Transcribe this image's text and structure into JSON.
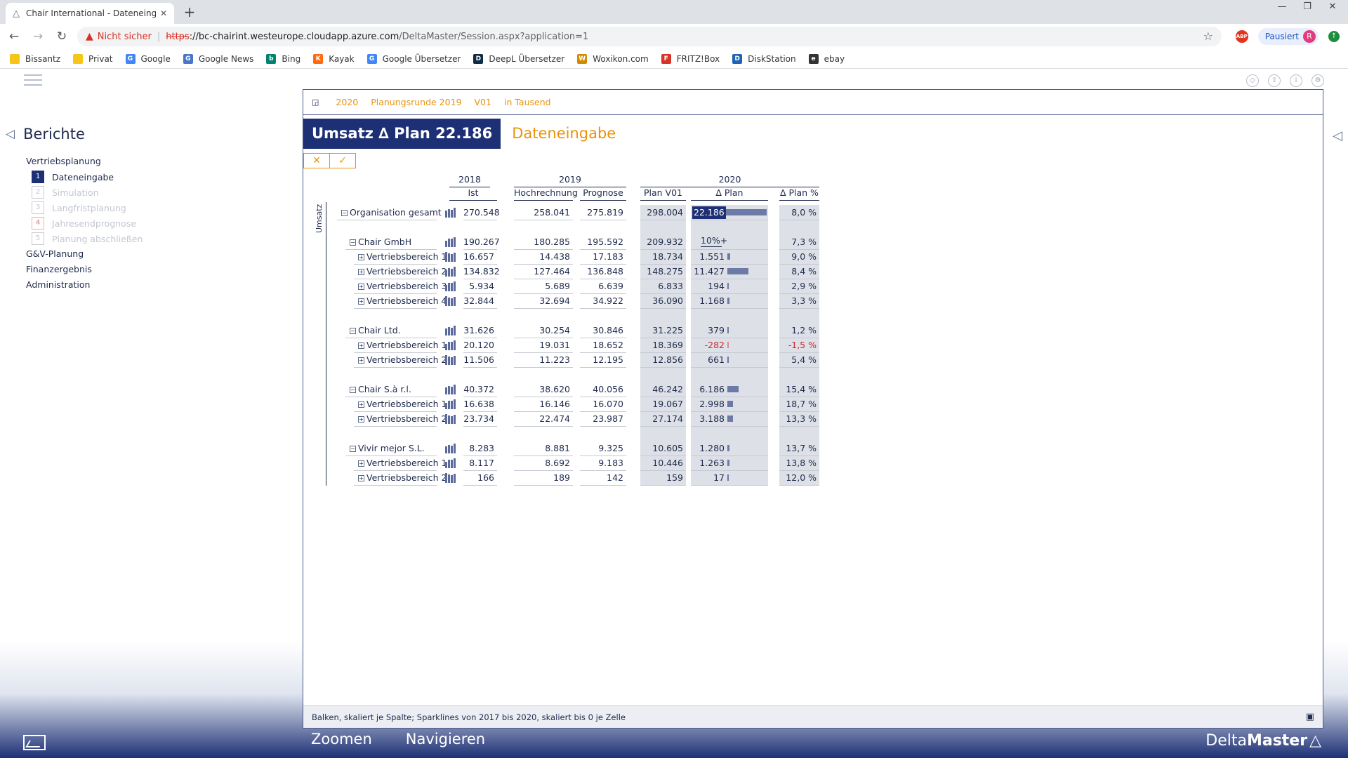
{
  "browser": {
    "tab_title": "Chair International - Dateneingabe",
    "new_tab": "+",
    "address": {
      "warning": "Nicht sicher",
      "scheme": "https",
      "host": "://bc-chairint.westeurope.cloudapp.azure.com",
      "path": "/DeltaMaster/Session.aspx?application=1"
    },
    "paused_label": "Pausiert",
    "profile_initial": "R",
    "abp_label": "ABP",
    "bookmarks": [
      {
        "label": "Bissantz",
        "color": "#f5c518"
      },
      {
        "label": "Privat",
        "color": "#f5c518"
      },
      {
        "label": "Google",
        "color": "#4285f4",
        "glyph": "G"
      },
      {
        "label": "Google News",
        "color": "#4a76c9",
        "glyph": "G"
      },
      {
        "label": "Bing",
        "color": "#008272",
        "glyph": "b"
      },
      {
        "label": "Kayak",
        "color": "#ff690f",
        "glyph": "K"
      },
      {
        "label": "Google Übersetzer",
        "color": "#4285f4",
        "glyph": "G"
      },
      {
        "label": "DeepL Übersetzer",
        "color": "#0f2b46",
        "glyph": "D"
      },
      {
        "label": "Woxikon.com",
        "color": "#d48a00",
        "glyph": "W"
      },
      {
        "label": "FRITZ!Box",
        "color": "#d9322b",
        "glyph": "F"
      },
      {
        "label": "DiskStation",
        "color": "#1e63b5",
        "glyph": "D"
      },
      {
        "label": "ebay",
        "color": "#333333",
        "glyph": "e"
      }
    ]
  },
  "nav": {
    "title": "Berichte",
    "groups_before": [
      "Vertriebsplanung"
    ],
    "steps": [
      {
        "num": "1",
        "label": "Dateneingabe",
        "state": "active"
      },
      {
        "num": "2",
        "label": "Simulation",
        "state": ""
      },
      {
        "num": "3",
        "label": "Langfristplanung",
        "state": ""
      },
      {
        "num": "4",
        "label": "Jahresendprognose",
        "state": "warn"
      },
      {
        "num": "5",
        "label": "Planung abschließen",
        "state": ""
      }
    ],
    "groups_after": [
      "G&V-Planung",
      "Finanzergebnis",
      "Administration"
    ]
  },
  "panel": {
    "crumbs": [
      "2020",
      "Planungsrunde 2019",
      "V01",
      "in Tausend"
    ],
    "kpi_title": "Umsatz ∆ Plan 22.186",
    "subtitle": "Dateneingabe",
    "cancel_label": "✕",
    "confirm_label": "✓",
    "footer_text": "Balken, skaliert je Spalte; Sparklines von 2017 bis 2020, skaliert bis 0 je Zelle"
  },
  "table": {
    "measure_label": "Umsatz",
    "years": [
      "2018",
      "2019",
      "2020"
    ],
    "columns": [
      "Ist",
      "Hochrechnung",
      "Prognose",
      "Plan V01",
      "∆ Plan",
      "∆ Plan %"
    ],
    "rows": [
      {
        "label": "Organisation gesamt",
        "level": 0,
        "expander": "⊟",
        "ist": "270.548",
        "hr": "258.041",
        "prog": "275.819",
        "plan": "298.004",
        "dplan": "22.186",
        "dpct": "8,0 %",
        "bar": 1.0,
        "edit": true
      },
      {
        "label": "Chair GmbH",
        "level": 1,
        "expander": "⊟",
        "ist": "190.267",
        "hr": "180.285",
        "prog": "195.592",
        "plan": "209.932",
        "dplan": "10%+",
        "dpct": "7,3 %",
        "bar": 0.0,
        "input": true
      },
      {
        "label": "Vertriebsbereich 1",
        "level": 2,
        "expander": "⊞",
        "ist": "16.657",
        "hr": "14.438",
        "prog": "17.183",
        "plan": "18.734",
        "dplan": "1.551",
        "dpct": "9,0 %",
        "bar": 0.136
      },
      {
        "label": "Vertriebsbereich 2",
        "level": 2,
        "expander": "⊞",
        "ist": "134.832",
        "hr": "127.464",
        "prog": "136.848",
        "plan": "148.275",
        "dplan": "11.427",
        "dpct": "8,4 %",
        "bar": 1.0
      },
      {
        "label": "Vertriebsbereich 3",
        "level": 2,
        "expander": "⊞",
        "ist": "5.934",
        "hr": "5.689",
        "prog": "6.639",
        "plan": "6.833",
        "dplan": "194",
        "dpct": "2,9 %",
        "bar": 0.017
      },
      {
        "label": "Vertriebsbereich 4",
        "level": 2,
        "expander": "⊞",
        "ist": "32.844",
        "hr": "32.694",
        "prog": "34.922",
        "plan": "36.090",
        "dplan": "1.168",
        "dpct": "3,3 %",
        "bar": 0.102
      },
      {
        "label": "Chair Ltd.",
        "level": 1,
        "expander": "⊟",
        "ist": "31.626",
        "hr": "30.254",
        "prog": "30.846",
        "plan": "31.225",
        "dplan": "379",
        "dpct": "1,2 %",
        "bar": 0.03,
        "gap": true
      },
      {
        "label": "Vertriebsbereich 1",
        "level": 2,
        "expander": "⊞",
        "ist": "20.120",
        "hr": "19.031",
        "prog": "18.652",
        "plan": "18.369",
        "dplan": "-282",
        "dpct": "-1,5 %",
        "bar": 0.03,
        "neg": true
      },
      {
        "label": "Vertriebsbereich 2",
        "level": 2,
        "expander": "⊞",
        "ist": "11.506",
        "hr": "11.223",
        "prog": "12.195",
        "plan": "12.856",
        "dplan": "661",
        "dpct": "5,4 %",
        "bar": 0.03
      },
      {
        "label": "Chair S.à r.l.",
        "level": 1,
        "expander": "⊟",
        "ist": "40.372",
        "hr": "38.620",
        "prog": "40.056",
        "plan": "46.242",
        "dplan": "6.186",
        "dpct": "15,4 %",
        "bar": 0.53,
        "gap": true
      },
      {
        "label": "Vertriebsbereich 1",
        "level": 2,
        "expander": "⊞",
        "ist": "16.638",
        "hr": "16.146",
        "prog": "16.070",
        "plan": "19.067",
        "dplan": "2.998",
        "dpct": "18,7 %",
        "bar": 0.26
      },
      {
        "label": "Vertriebsbereich 2",
        "level": 2,
        "expander": "⊞",
        "ist": "23.734",
        "hr": "22.474",
        "prog": "23.987",
        "plan": "27.174",
        "dplan": "3.188",
        "dpct": "13,3 %",
        "bar": 0.28
      },
      {
        "label": "Vivir mejor S.L.",
        "level": 1,
        "expander": "⊟",
        "ist": "8.283",
        "hr": "8.881",
        "prog": "9.325",
        "plan": "10.605",
        "dplan": "1.280",
        "dpct": "13,7 %",
        "bar": 0.11,
        "gap": true
      },
      {
        "label": "Vertriebsbereich 1",
        "level": 2,
        "expander": "⊞",
        "ist": "8.117",
        "hr": "8.692",
        "prog": "9.183",
        "plan": "10.446",
        "dplan": "1.263",
        "dpct": "13,8 %",
        "bar": 0.11
      },
      {
        "label": "Vertriebsbereich 2",
        "level": 2,
        "expander": "⊞",
        "ist": "166",
        "hr": "189",
        "prog": "142",
        "plan": "159",
        "dplan": "17",
        "dpct": "12,0 %",
        "bar": 0.015
      }
    ]
  },
  "bottom": {
    "zoom": "Zoomen",
    "navigate": "Navigieren",
    "brand_light": "Delta",
    "brand_bold": "Master"
  }
}
